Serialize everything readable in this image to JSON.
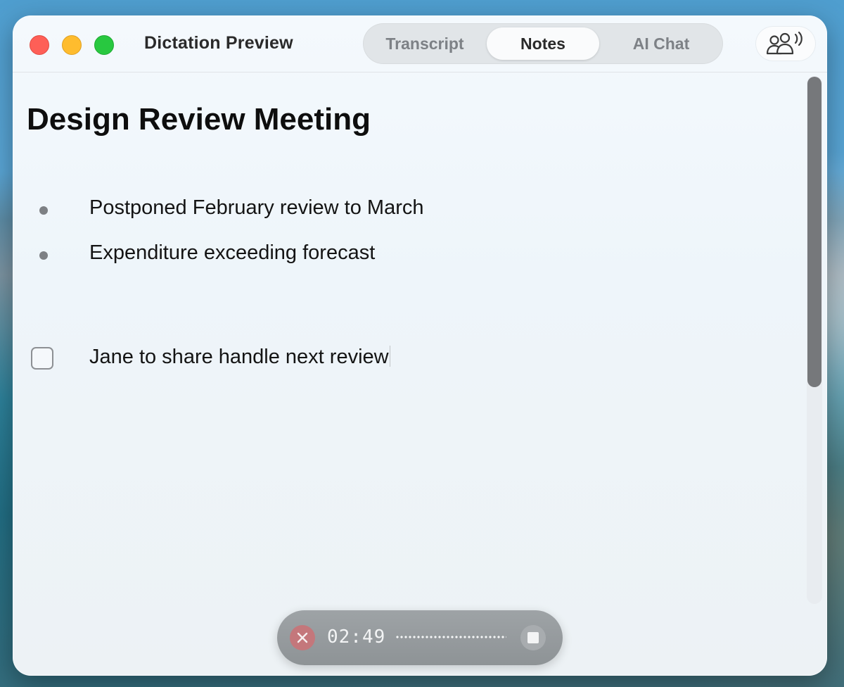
{
  "window": {
    "title": "Dictation Preview",
    "controls": [
      "close",
      "minimize",
      "zoom"
    ]
  },
  "tabs": [
    {
      "label": "Transcript",
      "selected": false
    },
    {
      "label": "Notes",
      "selected": true
    },
    {
      "label": "AI Chat",
      "selected": false
    }
  ],
  "toolbar": {
    "speakers_icon": "people-speaking-icon"
  },
  "note": {
    "title": "Design Review Meeting",
    "bullets": [
      "Postponed February review to March",
      "Expenditure exceeding forecast"
    ],
    "todos": [
      {
        "text": "Jane to share handle next review",
        "checked": false
      }
    ]
  },
  "recorder": {
    "elapsed": "02:49",
    "cancel_icon": "close-icon",
    "stop_icon": "stop-icon"
  },
  "colors": {
    "close": "#fe5f57",
    "minimize": "#febc2e",
    "zoom": "#28c840",
    "cancel_button": "#c4777b"
  }
}
